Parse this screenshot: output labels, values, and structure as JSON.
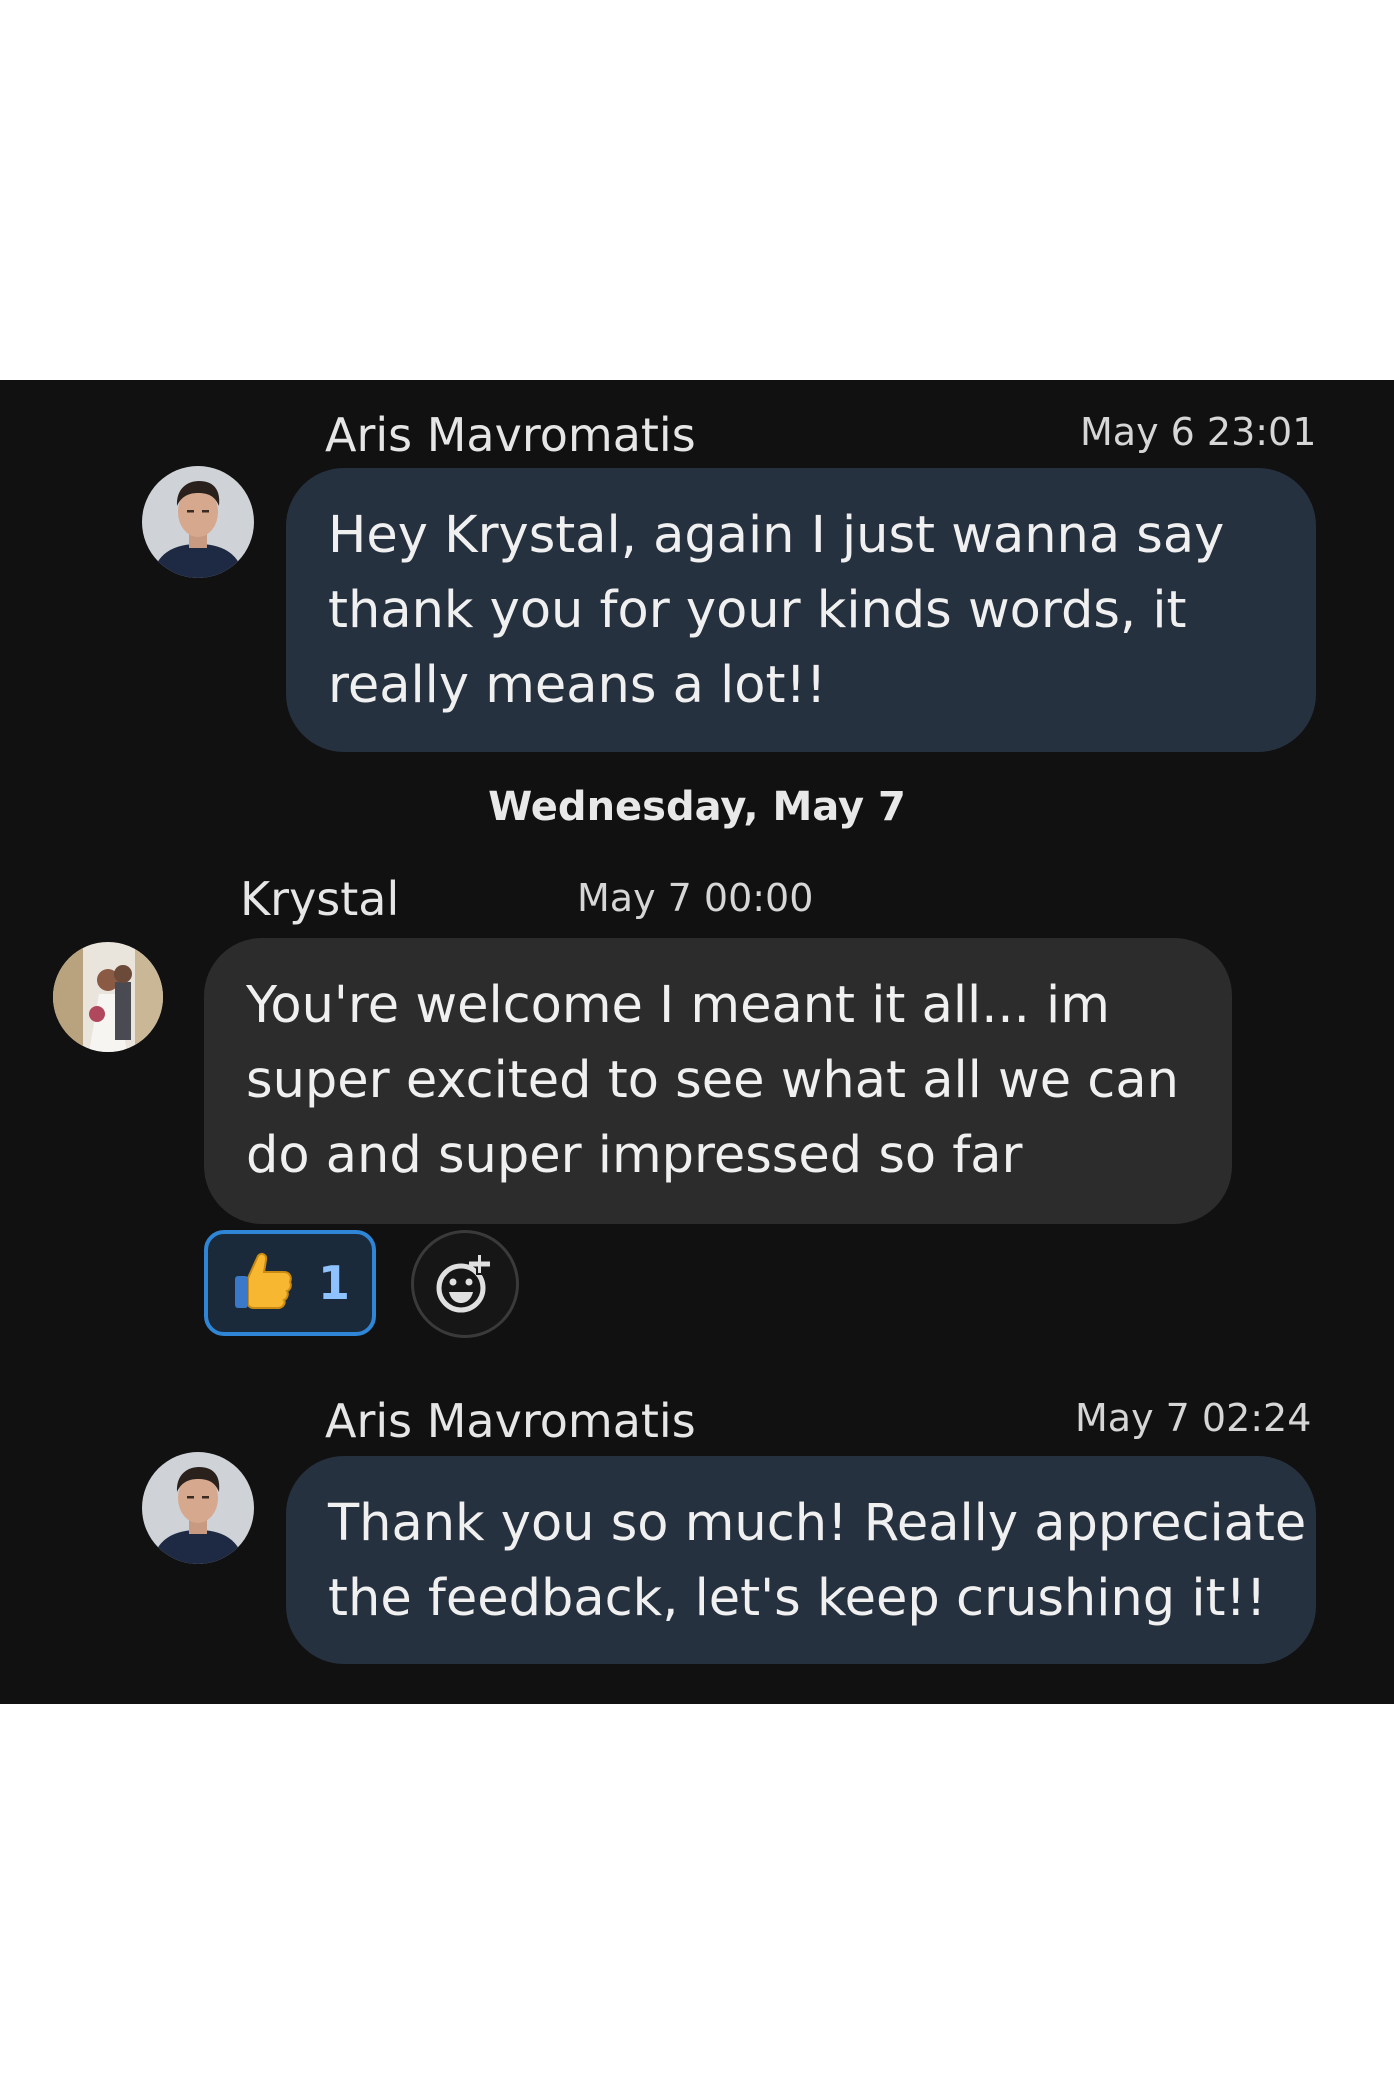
{
  "messages": [
    {
      "sender": "Aris Mavromatis",
      "timestamp": "May 6 23:01",
      "lines": [
        "Hey Krystal, again I just wanna say",
        "thank you for your kinds words, it",
        "really means a lot!!"
      ]
    },
    {
      "sender": "Krystal",
      "timestamp": "May 7 00:00",
      "lines": [
        "You're welcome I meant it all... im",
        "super excited to see what all we can",
        "do and super impressed so far"
      ],
      "reaction": {
        "emoji": "👍",
        "count": "1"
      }
    },
    {
      "sender": "Aris Mavromatis",
      "timestamp": "May 7 02:24",
      "lines": [
        "Thank you so much! Really appreciate",
        "the feedback, let's keep crushing it!!"
      ]
    }
  ],
  "date_divider": "Wednesday, May 7",
  "icons": {
    "add_reaction": "add-reaction-icon",
    "thumbs_up": "thumbs-up-emoji"
  },
  "colors": {
    "background": "#111111",
    "outgoing_bubble": "#26313f",
    "incoming_bubble": "#2c2c2c",
    "reaction_border": "#2f86d6",
    "reaction_count": "#8fc3ff"
  }
}
